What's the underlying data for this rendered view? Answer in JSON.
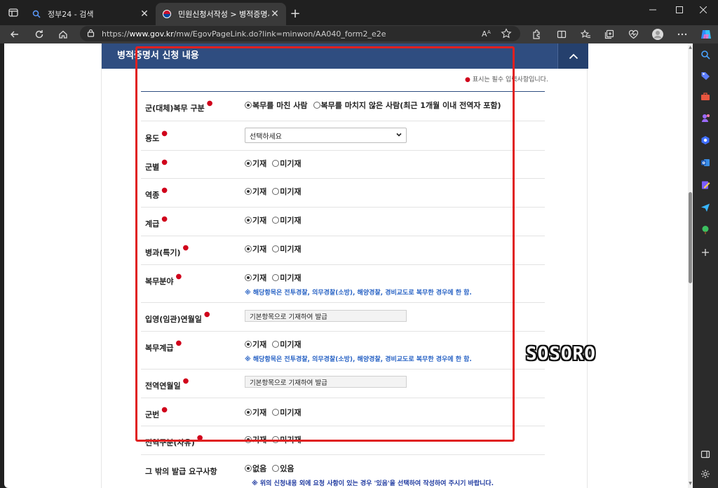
{
  "browser": {
    "tabs": [
      {
        "title": "정부24 - 검색",
        "active": false
      },
      {
        "title": "민원신청서작성 > 병적증명서 발",
        "active": true
      }
    ],
    "url_prefix": "https://",
    "url_domain": "www.gov.kr",
    "url_path": "/mw/EgovPageLink.do?link=minwon/AA040_form2_e2e",
    "accent": "#2f4d80"
  },
  "section": {
    "title": "병적증명서 신청 내용",
    "required_note": "표시는 필수 입력사항입니다."
  },
  "form": {
    "rows": [
      {
        "label": "군(대체)복무 구분",
        "opt1": "복무를 마친 사람",
        "opt2": "복무를 마치지 않은 사람(최근 1개월 이내 전역자 포함)"
      },
      {
        "label": "용도",
        "select_value": "선택하세요"
      },
      {
        "label": "군별",
        "opt1": "기재",
        "opt2": "미기재"
      },
      {
        "label": "역종",
        "opt1": "기재",
        "opt2": "미기재"
      },
      {
        "label": "계급",
        "opt1": "기재",
        "opt2": "미기재"
      },
      {
        "label": "병과(특기)",
        "opt1": "기재",
        "opt2": "미기재"
      },
      {
        "label": "복무분야",
        "opt1": "기재",
        "opt2": "미기재",
        "note": "※ 해당항목은 전투경찰, 의무경찰(소방), 해양경찰, 경비교도로 복무한 경우에 한 함."
      },
      {
        "label": "입영(임관)연월일",
        "input_value": "기본항목으로 기재하여 발급"
      },
      {
        "label": "복무계급",
        "opt1": "기재",
        "opt2": "미기재",
        "note": "※ 해당항목은 전투경찰, 의무경찰(소방), 해양경찰, 경비교도로 복무한 경우에 한 함."
      },
      {
        "label": "전역연월일",
        "input_value": "기본항목으로 기재하여 발급"
      },
      {
        "label": "군번",
        "opt1": "기재",
        "opt2": "미기재"
      },
      {
        "label": "전역구분(사유)",
        "opt1": "기재",
        "opt2": "미기재"
      },
      {
        "label": "그 밖의 발급 요구사항",
        "opt1": "없음",
        "opt2": "있음",
        "note": "※ 위의 신청내용 외에 요청 사항이 있는 경우 '있음'을 선택하여 작성하여 주시기 바랍니다."
      }
    ]
  },
  "watermark": "SOSORO"
}
